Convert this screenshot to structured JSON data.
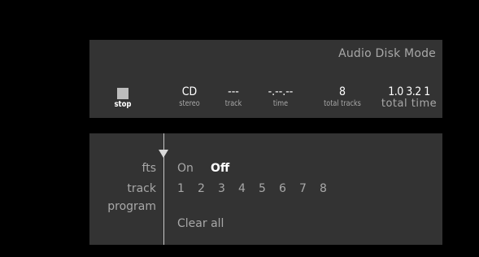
{
  "status": {
    "mode_title": "Audio Disk Mode",
    "stop_label": "stop",
    "format_value": "CD",
    "format_label": "stereo",
    "track_value": "---",
    "track_label": "track",
    "time_value": "-.--.--",
    "time_label": "time",
    "total_tracks_value": "8",
    "total_tracks_label": "total tracks",
    "total_time_value": "1.0 3.2 1",
    "total_time_label": "total time"
  },
  "program": {
    "labels": {
      "fts": "fts",
      "track": "track",
      "program": "program"
    },
    "fts_options": {
      "on": "On",
      "off": "Off",
      "selected": "Off"
    },
    "tracks": [
      "1",
      "2",
      "3",
      "4",
      "5",
      "6",
      "7",
      "8"
    ],
    "clear_all": "Clear all"
  },
  "colors": {
    "background": "#000000",
    "panel": "#333333",
    "text_dim": "#a8a8a8",
    "text_bright": "#ffffff"
  }
}
